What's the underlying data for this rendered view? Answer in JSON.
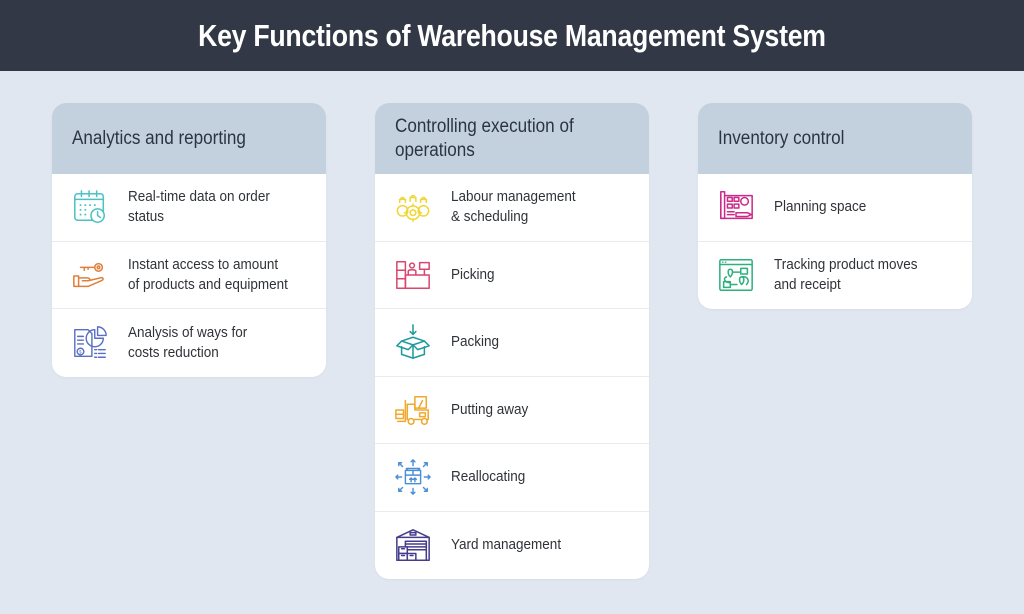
{
  "title": "Key Functions of Warehouse Management System",
  "columns": [
    {
      "heading": "Analytics and reporting",
      "items": [
        {
          "label": "Real-time data on order\nstatus",
          "icon": "calendar-clock-icon",
          "color": "#4cc2c4"
        },
        {
          "label": "Instant access to amount\nof products and equipment",
          "icon": "hand-key-icon",
          "color": "#e07f3c"
        },
        {
          "label": "Analysis of ways for\ncosts reduction",
          "icon": "report-pie-chart-icon",
          "color": "#5a6fc4"
        }
      ]
    },
    {
      "heading": "Controlling execution of\noperations",
      "items": [
        {
          "label": "Labour management\n& scheduling",
          "icon": "workers-gears-icon",
          "color": "#f0d632"
        },
        {
          "label": "Picking",
          "icon": "picking-desk-icon",
          "color": "#d9476f"
        },
        {
          "label": "Packing",
          "icon": "box-arrow-icon",
          "color": "#1f9a9c"
        },
        {
          "label": "Putting away",
          "icon": "forklift-icon",
          "color": "#f0a92e"
        },
        {
          "label": "Reallocating",
          "icon": "box-arrows-icon",
          "color": "#4b8ed6"
        },
        {
          "label": "Yard management",
          "icon": "warehouse-icon",
          "color": "#463c8c"
        }
      ]
    },
    {
      "heading": "Inventory control",
      "items": [
        {
          "label": "Planning space",
          "icon": "blueprint-pencil-icon",
          "color": "#cc2a8a"
        },
        {
          "label": "Tracking product moves\nand receipt",
          "icon": "map-tracking-icon",
          "color": "#2eb07e"
        }
      ]
    }
  ],
  "colors": {
    "title_bar": "#323846",
    "background": "#e1e7f0",
    "card_header": "#c3d1df"
  }
}
